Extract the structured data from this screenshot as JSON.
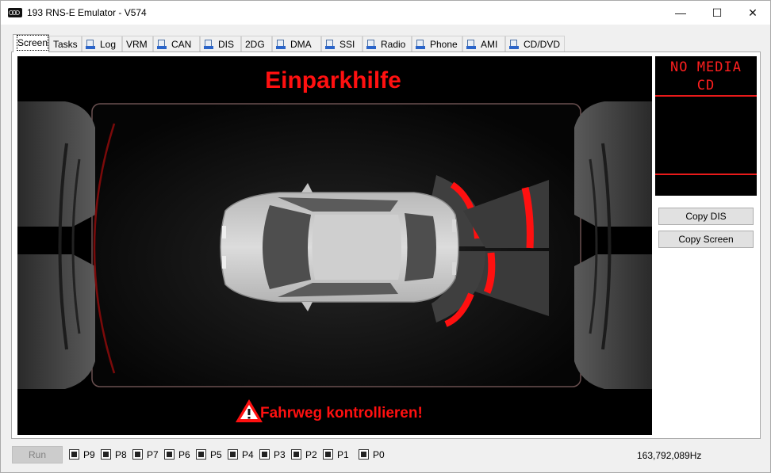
{
  "window": {
    "title": "193 RNS-E Emulator - V574",
    "minimize_glyph": "—",
    "maximize_glyph": "☐",
    "close_glyph": "✕"
  },
  "tabs": [
    {
      "label": "Screen",
      "icon": false
    },
    {
      "label": "Tasks",
      "icon": false
    },
    {
      "label": "Log",
      "icon": true
    },
    {
      "label": "VRM",
      "icon": false
    },
    {
      "label": "CAN",
      "icon": true
    },
    {
      "label": "DIS",
      "icon": true
    },
    {
      "label": "2DG",
      "icon": false
    },
    {
      "label": "DMA",
      "icon": true
    },
    {
      "label": "SSI",
      "icon": true
    },
    {
      "label": "Radio",
      "icon": true
    },
    {
      "label": "Phone",
      "icon": true
    },
    {
      "label": "AMI",
      "icon": true
    },
    {
      "label": "CD/DVD",
      "icon": true
    }
  ],
  "active_tab": "Screen",
  "screen": {
    "title": "Einparkhilfe",
    "warning": "Fahrweg kontrollieren!",
    "accent_color": "#ff1010"
  },
  "dis": {
    "line1": "NO MEDIA",
    "line2": "CD",
    "text_color": "#ff1f1f"
  },
  "buttons": {
    "copy_dis": "Copy DIS",
    "copy_screen": "Copy Screen"
  },
  "statusbar": {
    "run_label": "Run",
    "indicators": [
      "P9",
      "P8",
      "P7",
      "P6",
      "P5",
      "P4",
      "P3",
      "P2",
      "P1",
      "P0"
    ],
    "frequency": "163,792,089Hz"
  }
}
